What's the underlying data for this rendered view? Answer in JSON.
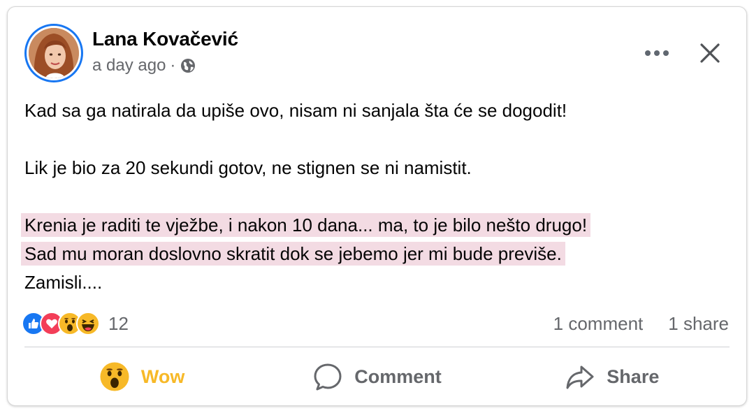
{
  "post": {
    "author": "Lana Kovačević",
    "time": "a day ago",
    "separator": "·",
    "paragraphs": {
      "p1": "Kad sa ga natirala da upiše ovo, nisam ni sanjala šta će se dogodit!",
      "p2": "Lik je bio za 20 sekundi gotov, ne stignen se ni namistit.",
      "p3a": "Krenia je raditi te vježbe, i nakon 10 dana... ma, to je bilo nešto drugo!",
      "p3b": "Sad mu moran doslovno skratit dok se jebemo jer mi bude previše.",
      "p4": "Zamisli...."
    }
  },
  "stats": {
    "reaction_count": "12",
    "comments": "1 comment",
    "shares": "1 share",
    "reaction_icons": [
      "like-icon",
      "love-icon",
      "wow-icon",
      "haha-icon"
    ]
  },
  "actions": {
    "wow": "Wow",
    "comment": "Comment",
    "share": "Share"
  },
  "colors": {
    "highlight": "#f3dbe3",
    "facebook_blue": "#1877f2",
    "love_red": "#f33e58",
    "reaction_yellow": "#f7b928",
    "secondary_text": "#65676b"
  }
}
